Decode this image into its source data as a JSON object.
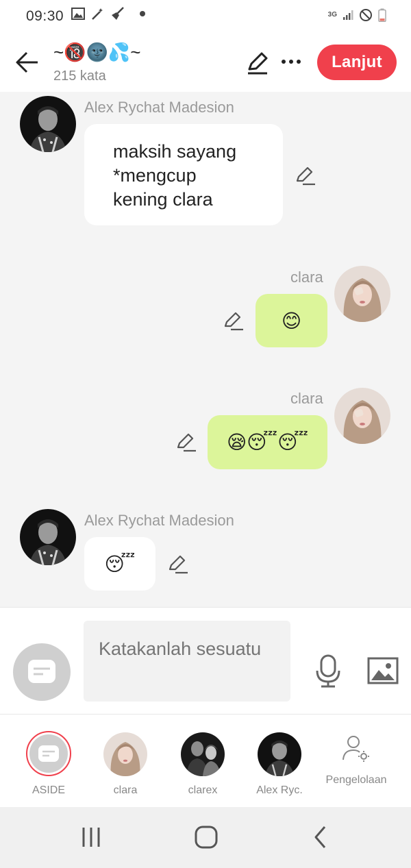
{
  "status_bar": {
    "time": "09:30",
    "network": "3G",
    "left_icons": [
      "image-icon",
      "magic-wand-icon",
      "broom-icon",
      "dot-icon"
    ],
    "right_icons": [
      "signal-icon",
      "do-not-disturb-icon",
      "battery-icon"
    ]
  },
  "header": {
    "title": "~🔞🌚💦~",
    "word_count": "215 kata",
    "next_label": "Lanjut",
    "accent_color": "#f0404c"
  },
  "messages": [
    {
      "sender": "Alex Rychat Madesion",
      "side": "left",
      "text_lines": [
        "maksih sayang",
        "*mengcup",
        "kening clara"
      ]
    },
    {
      "sender": "clara",
      "side": "right",
      "text": "😊"
    },
    {
      "sender": "clara",
      "side": "right",
      "text": "😪😴😴"
    },
    {
      "sender": "Alex Rychat Madesion",
      "side": "left",
      "text": "😴"
    }
  ],
  "input": {
    "placeholder": "Katakanlah sesuatu"
  },
  "characters": [
    {
      "label": "ASIDE"
    },
    {
      "label": "clara"
    },
    {
      "label": "clarex"
    },
    {
      "label": "Alex Ryc."
    },
    {
      "label": "Pengelolaan"
    }
  ],
  "colors": {
    "bubble_right": "#dcf59a",
    "bubble_left": "#ffffff",
    "background": "#f4f4f4"
  }
}
